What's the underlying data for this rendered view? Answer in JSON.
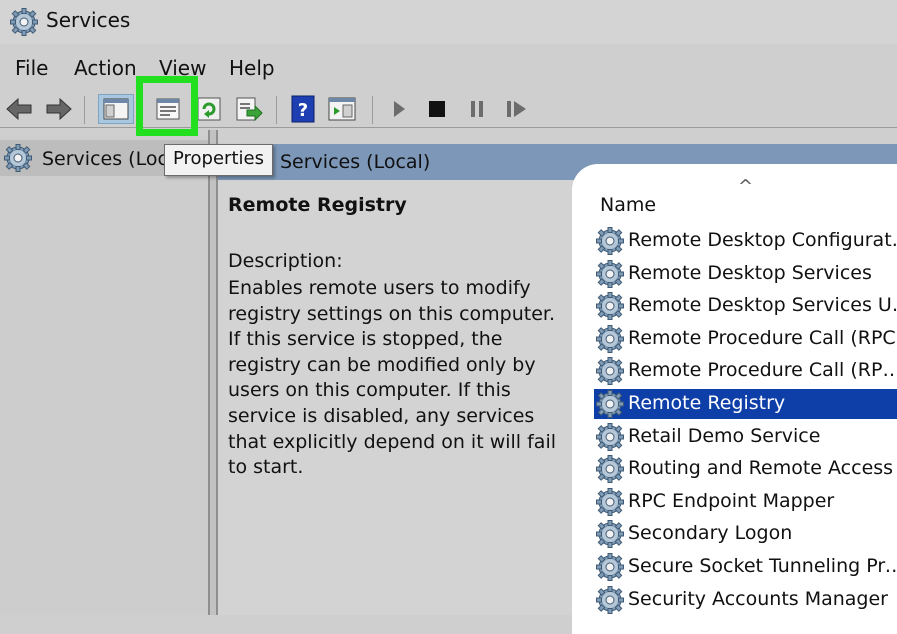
{
  "window": {
    "title": "Services"
  },
  "menu": [
    "File",
    "Action",
    "View",
    "Help"
  ],
  "toolbar": {
    "icons": [
      "back-arrow-icon",
      "forward-arrow-icon",
      "show-hide-console-tree-icon",
      "properties-icon",
      "refresh-icon",
      "export-list-icon",
      "help-icon",
      "show-action-pane-icon",
      "play-icon",
      "stop-icon",
      "pause-icon",
      "restart-icon"
    ]
  },
  "tooltip": "Properties",
  "tree": {
    "item_label": "Services (Loca"
  },
  "right_header": {
    "title": "Services (Local)"
  },
  "description": {
    "service_name": "Remote Registry",
    "label": "Description:",
    "text": "Enables remote users to modify registry settings on this computer. If this service is stopped, the registry can be modified only by users on this computer. If this service is disabled, any services that explicitly depend on it will fail to start."
  },
  "list": {
    "sort_indicator": "^",
    "column_name": "Name",
    "rows": [
      "Remote Desktop Configurati...",
      "Remote Desktop Services",
      "Remote Desktop Services Us...",
      "Remote Procedure Call (RPC)",
      "Remote Procedure Call (RPC)...",
      "Remote Registry",
      "Retail Demo Service",
      "Routing and Remote Access",
      "RPC Endpoint Mapper",
      "Secondary Logon",
      "Secure Socket Tunneling Pro...",
      "Security Accounts Manager"
    ],
    "selected_index": 5
  },
  "colors": {
    "selection": "#0e3ea8",
    "header_bar": "#7d97b8",
    "highlight": "#22e01f"
  }
}
